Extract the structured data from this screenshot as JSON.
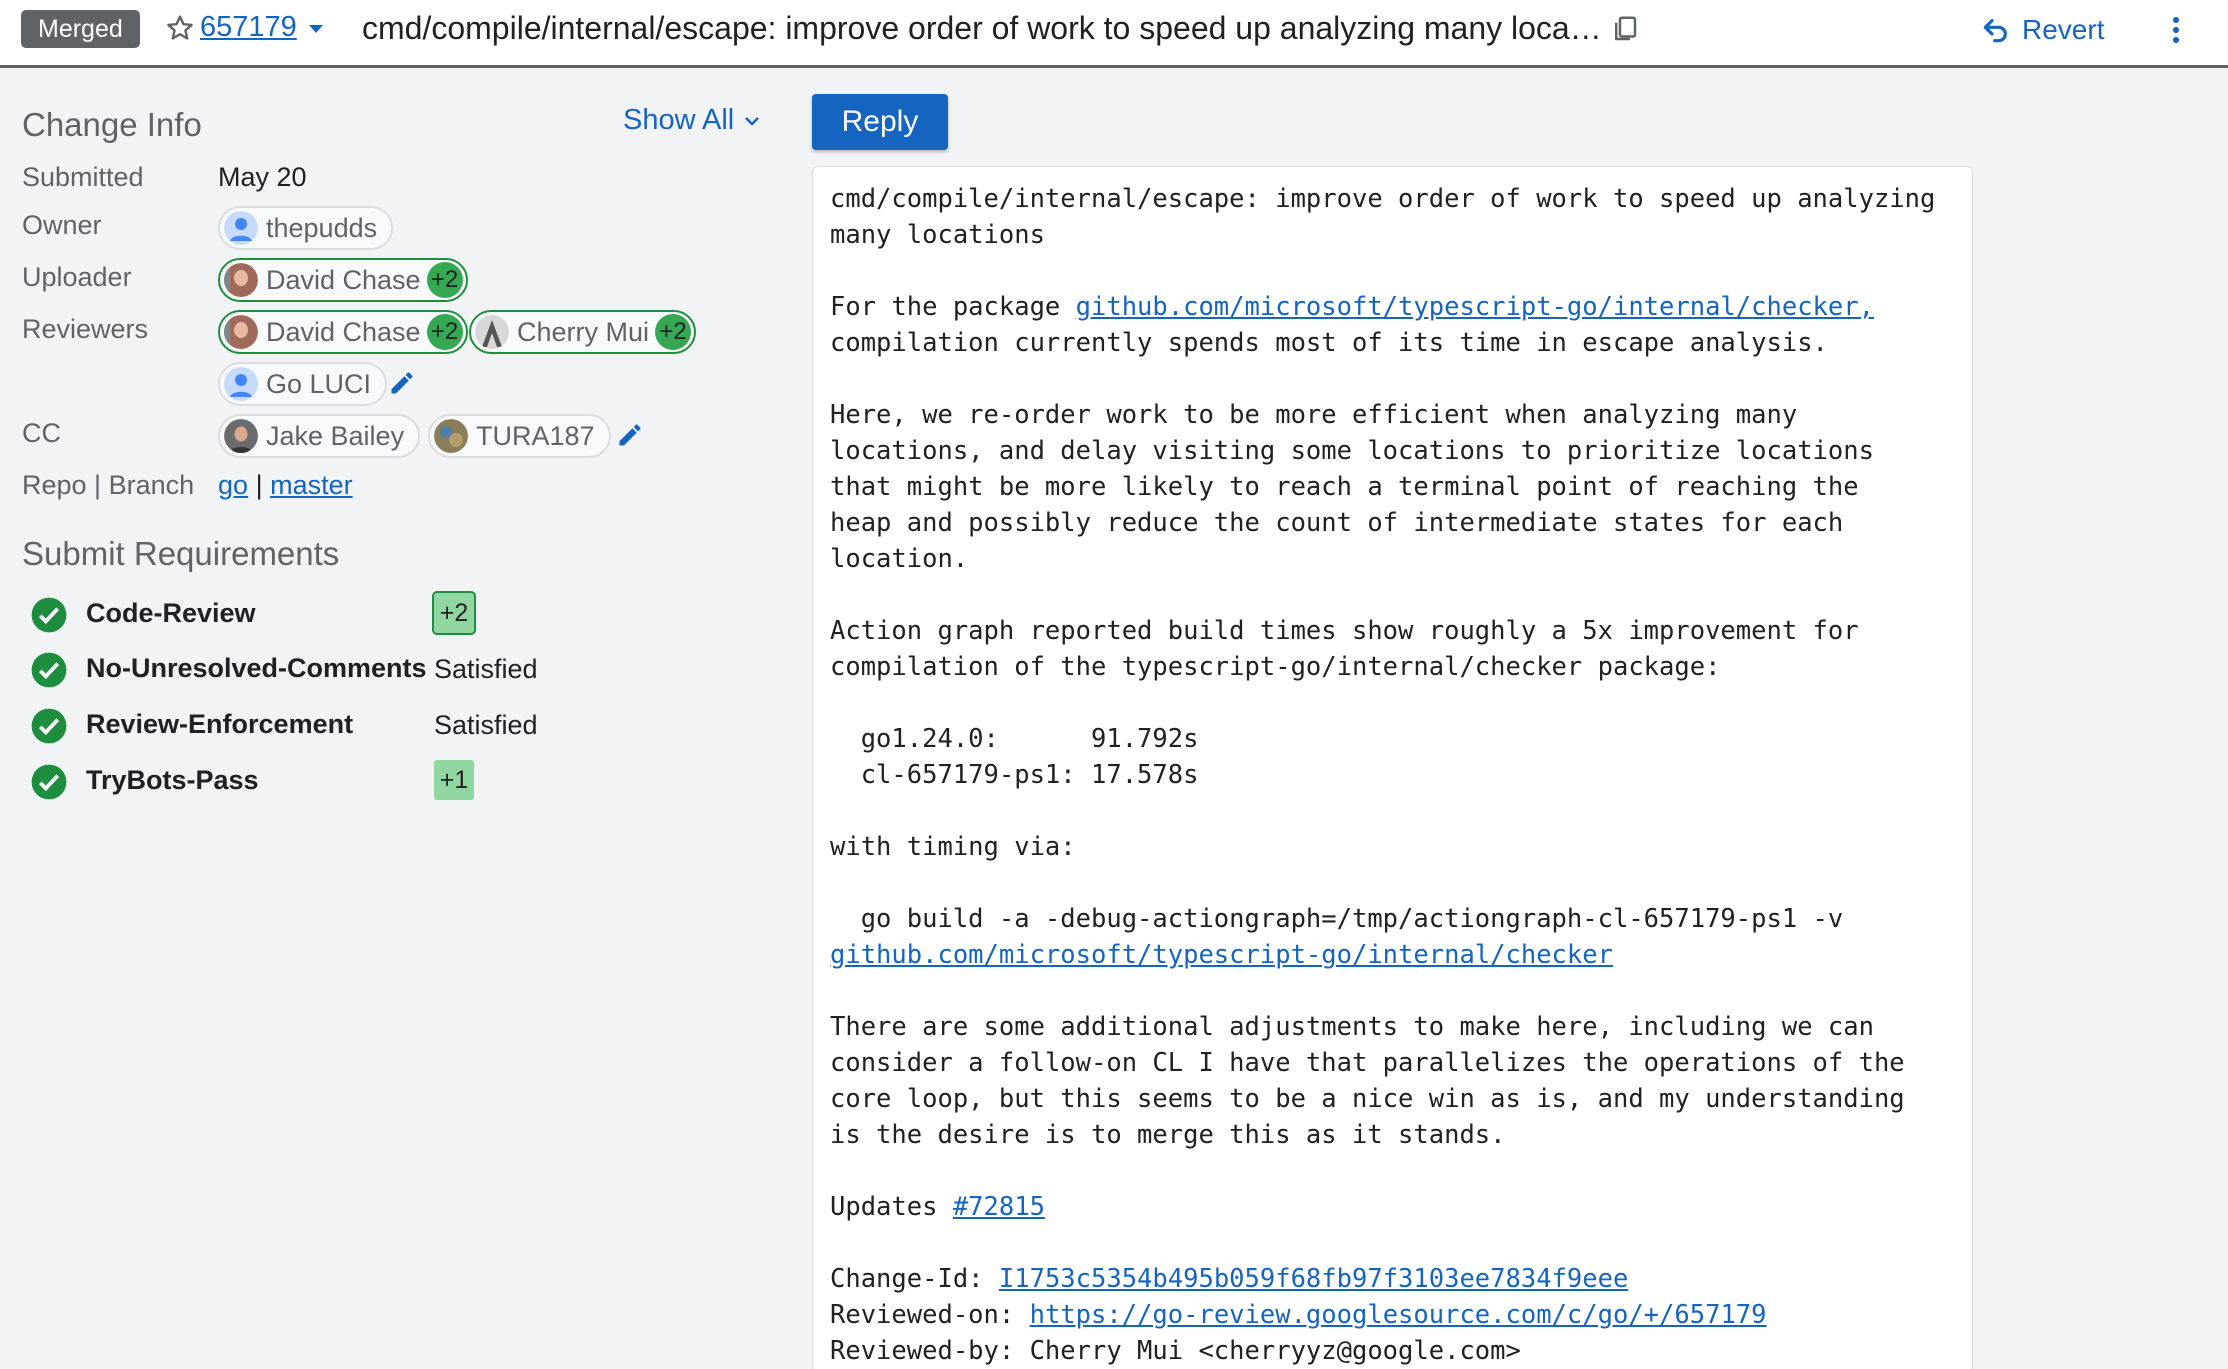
{
  "header": {
    "status": "Merged",
    "change_number": "657179",
    "title": "cmd/compile/internal/escape: improve order of work to speed up analyzing many locations",
    "revert_label": "Revert"
  },
  "change_info": {
    "title": "Change Info",
    "show_all": "Show All",
    "submitted_label": "Submitted",
    "submitted_value": "May 20",
    "owner_label": "Owner",
    "owner_name": "thepudds",
    "uploader_label": "Uploader",
    "uploader_name": "David Chase",
    "uploader_vote": "+2",
    "reviewers_label": "Reviewers",
    "reviewers": [
      {
        "name": "David Chase",
        "vote": "+2"
      },
      {
        "name": "Cherry Mui",
        "vote": "+2"
      },
      {
        "name": "Go LUCI",
        "vote": ""
      }
    ],
    "cc_label": "CC",
    "cc": [
      {
        "name": "Jake Bailey"
      },
      {
        "name": "TURA187"
      }
    ],
    "repo_branch_label": "Repo | Branch",
    "repo": "go",
    "separator": "|",
    "branch": "master"
  },
  "submit_requirements": {
    "title": "Submit Requirements",
    "items": [
      {
        "name": "Code-Review",
        "status": "+2"
      },
      {
        "name": "No-Unresolved-Comments",
        "status": "Satisfied"
      },
      {
        "name": "Review-Enforcement",
        "status": "Satisfied"
      },
      {
        "name": "TryBots-Pass",
        "status": "+1"
      }
    ]
  },
  "reply_label": "Reply",
  "commit": {
    "line1": "cmd/compile/internal/escape: improve order of work to speed up analyzing",
    "line2": "many locations",
    "p1_prefix": "For the package ",
    "p1_link": "github.com/microsoft/typescript-go/internal/checker,",
    "p1_rest": "compilation currently spends most of its time in escape analysis.",
    "p2": "Here, we re-order work to be more efficient when analyzing many\nlocations, and delay visiting some locations to prioritize locations\nthat might be more likely to reach a terminal point of reaching the\nheap and possibly reduce the count of intermediate states for each\nlocation.",
    "p3": "Action graph reported build times show roughly a 5x improvement for\ncompilation of the typescript-go/internal/checker package:",
    "p4": "  go1.24.0:      91.792s\n  cl-657179-ps1: 17.578s",
    "p5": "with timing via:",
    "p6_cmd": "  go build -a -debug-actiongraph=/tmp/actiongraph-cl-657179-ps1 -v",
    "p6_link": "github.com/microsoft/typescript-go/internal/checker",
    "p7": "There are some additional adjustments to make here, including we can\nconsider a follow-on CL I have that parallelizes the operations of the\ncore loop, but this seems to be a nice win as is, and my understanding\nis the desire is to merge this as it stands.",
    "updates_prefix": "Updates ",
    "updates_link": "#72815",
    "change_id_prefix": "Change-Id: ",
    "change_id": "I1753c5354b495b059f68fb97f3103ee7834f9eee",
    "reviewed_on_prefix": "Reviewed-on: ",
    "reviewed_on": "https://go-review.googlesource.com/c/go/+/657179",
    "reviewed_by": "Reviewed-by: Cherry Mui <cherryyz@google.com>"
  },
  "colors": {
    "accent": "#1565c0",
    "merged_badge": "#5f6368",
    "vote_green": "#34a853",
    "check_green": "#1e8e3e"
  }
}
